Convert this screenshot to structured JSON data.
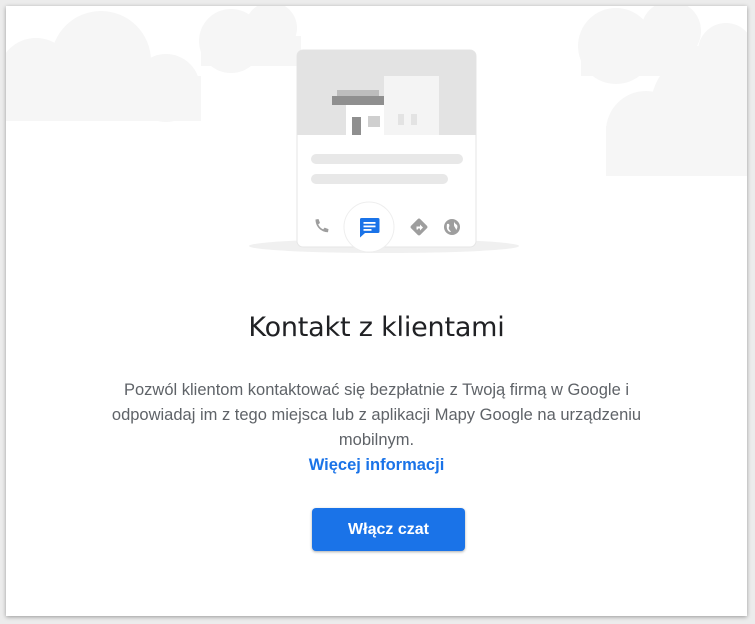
{
  "dialog": {
    "title": "Kontakt z klientami",
    "description": "Pozwól klientom kontaktować się bezpłatnie z Twoją firmą w Google i odpowiadaj im z tego miejsca lub z aplikacji Mapy Google na urządzeniu mobilnym.",
    "more_link": "Więcej informacji",
    "enable_button": "Włącz czat"
  },
  "illustration": {
    "icons": [
      "phone-icon",
      "chat-icon",
      "directions-icon",
      "website-icon"
    ]
  },
  "colors": {
    "accent": "#1a73e8",
    "title": "#202124",
    "body_text": "#5f6368",
    "cloud": "#f6f6f6",
    "placeholder": "#e3e3e3",
    "icon_gray": "#9e9e9e"
  }
}
